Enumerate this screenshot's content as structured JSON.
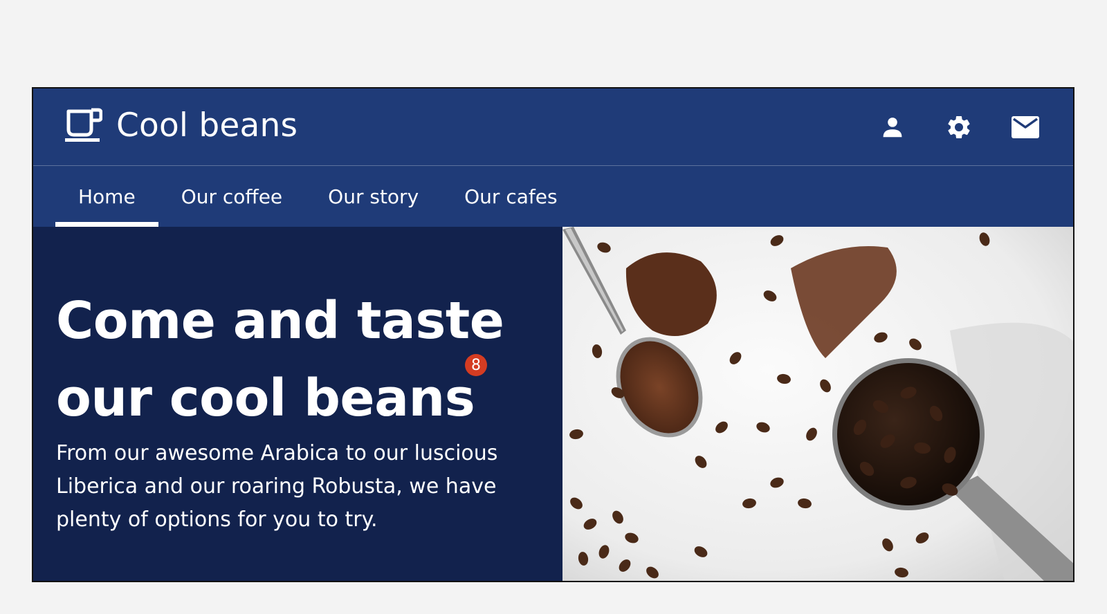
{
  "brand": {
    "title": "Cool beans",
    "logo_icon": "coffee-cup-icon"
  },
  "header_icons": [
    {
      "name": "user-icon"
    },
    {
      "name": "settings-gear-icon"
    },
    {
      "name": "mail-icon"
    }
  ],
  "nav": {
    "items": [
      {
        "label": "Home",
        "active": true
      },
      {
        "label": "Our coffee",
        "active": false
      },
      {
        "label": "Our story",
        "active": false
      },
      {
        "label": "Our cafes",
        "active": false
      }
    ]
  },
  "hero": {
    "title_line1": "Come and taste",
    "title_line2": "our cool beans",
    "badge_count": "8",
    "body": "From our awesome Arabica to our luscious Liberica and our roaring Robusta, we have plenty of options for you to try."
  },
  "colors": {
    "header_bg": "#1f3b78",
    "hero_bg": "#12224d",
    "badge": "#d43c22",
    "page_bg": "#f3f3f3"
  }
}
